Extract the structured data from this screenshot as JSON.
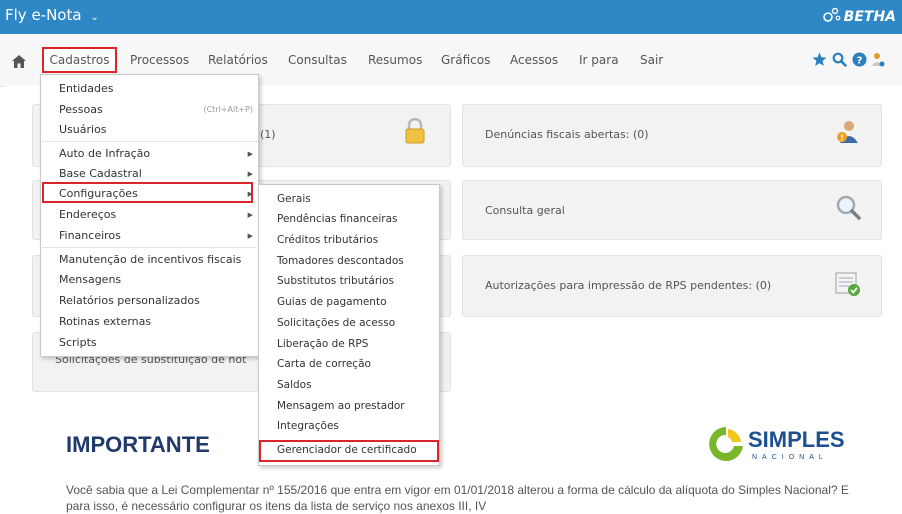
{
  "header": {
    "app_title": "Fly e-Nota",
    "app_caret": "⌄",
    "brand": "BETHA"
  },
  "nav": {
    "items": [
      "Cadastros",
      "Processos",
      "Relatórios",
      "Consultas",
      "Resumos",
      "Gráficos",
      "Acessos",
      "Ir para",
      "Sair"
    ]
  },
  "cards": {
    "card1_value": "(1)",
    "denuncias": "Denúncias fiscais abertas: (0)",
    "consulta": "Consulta geral",
    "autorizacoes": "Autorizações para impressão de RPS pendentes: (0)",
    "solicitacoes": "Solicitações de substituição de not"
  },
  "menu": {
    "entidades": "Entidades",
    "pessoas": "Pessoas",
    "pessoas_shortcut": "(Ctrl+Alt+P)",
    "usuarios": "Usuários",
    "auto_infracao": "Auto de Infração",
    "base_cadastral": "Base Cadastral",
    "configuracoes": "Configurações",
    "enderecos": "Endereços",
    "financeiros": "Financeiros",
    "manutencao": "Manutenção de incentivos fiscais",
    "mensagens": "Mensagens",
    "relatorios_personalizados": "Relatórios personalizados",
    "rotinas_externas": "Rotinas externas",
    "scripts": "Scripts"
  },
  "submenu": {
    "items": [
      "Gerais",
      "Pendências financeiras",
      "Créditos tributários",
      "Tomadores descontados",
      "Substitutos tributários",
      "Guias de pagamento",
      "Solicitações de acesso",
      "Liberação de RPS",
      "Carta de correção",
      "Saldos",
      "Mensagem ao prestador",
      "Integrações",
      "Gerenciador de certificado"
    ]
  },
  "notice": {
    "title": "IMPORTANTE",
    "simples_main": "SIMPLES",
    "simples_sub": "NACIONAL",
    "text": "Você sabia que a Lei Complementar nº 155/2016 que entra em vigor em 01/01/2018 alterou a forma de cálculo da alíquota do Simples Nacional? E para isso, é necessário configurar os itens da lista de serviço nos anexos III, IV"
  },
  "colors": {
    "topbar": "#2e88c6",
    "highlight": "#d9262c",
    "title_blue": "#1f3a6b",
    "simples_green": "#7ab62a"
  }
}
